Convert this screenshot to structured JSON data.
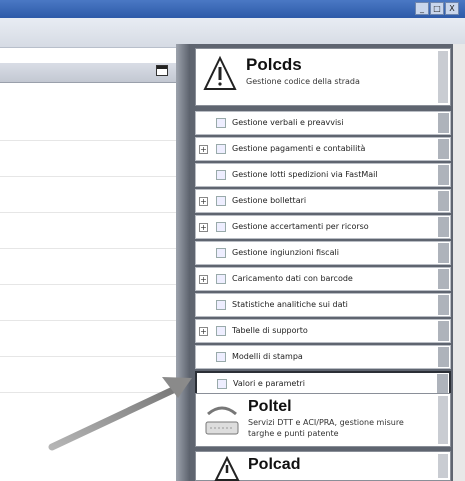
{
  "window": {
    "buttons": [
      "_",
      "□",
      "X"
    ]
  },
  "polcds": {
    "title": "Polcds",
    "subtitle": "Gestione codice della strada"
  },
  "menu": {
    "items": [
      {
        "label": "Gestione verbali e preavvisi",
        "expandable": false,
        "icon": "document-icon"
      },
      {
        "label": "Gestione pagamenti e contabilità",
        "expandable": true,
        "icon": "coins-icon"
      },
      {
        "label": "Gestione lotti spedizioni via FastMail",
        "expandable": false,
        "icon": "mail-icon"
      },
      {
        "label": "Gestione bollettari",
        "expandable": true,
        "icon": "book-icon"
      },
      {
        "label": "Gestione accertamenti per ricorso",
        "expandable": true,
        "icon": "pen-icon"
      },
      {
        "label": "Gestione ingiunzioni fiscali",
        "expandable": false,
        "icon": "document-icon"
      },
      {
        "label": "Caricamento dati con barcode",
        "expandable": true,
        "icon": "barcode-icon"
      },
      {
        "label": "Statistiche analitiche sui dati",
        "expandable": false,
        "icon": "chart-icon"
      },
      {
        "label": "Tabelle di supporto",
        "expandable": true,
        "icon": "table-icon"
      },
      {
        "label": "Modelli di stampa",
        "expandable": false,
        "icon": "print-icon"
      },
      {
        "label": "Valori e parametri",
        "expandable": false,
        "icon": "wrench-icon",
        "selected": true
      }
    ]
  },
  "poltel": {
    "title": "Poltel",
    "subtitle": "Servizi DTT e ACI/PRA, gestione misure targhe e punti patente"
  },
  "polcad": {
    "title": "Polcad"
  }
}
